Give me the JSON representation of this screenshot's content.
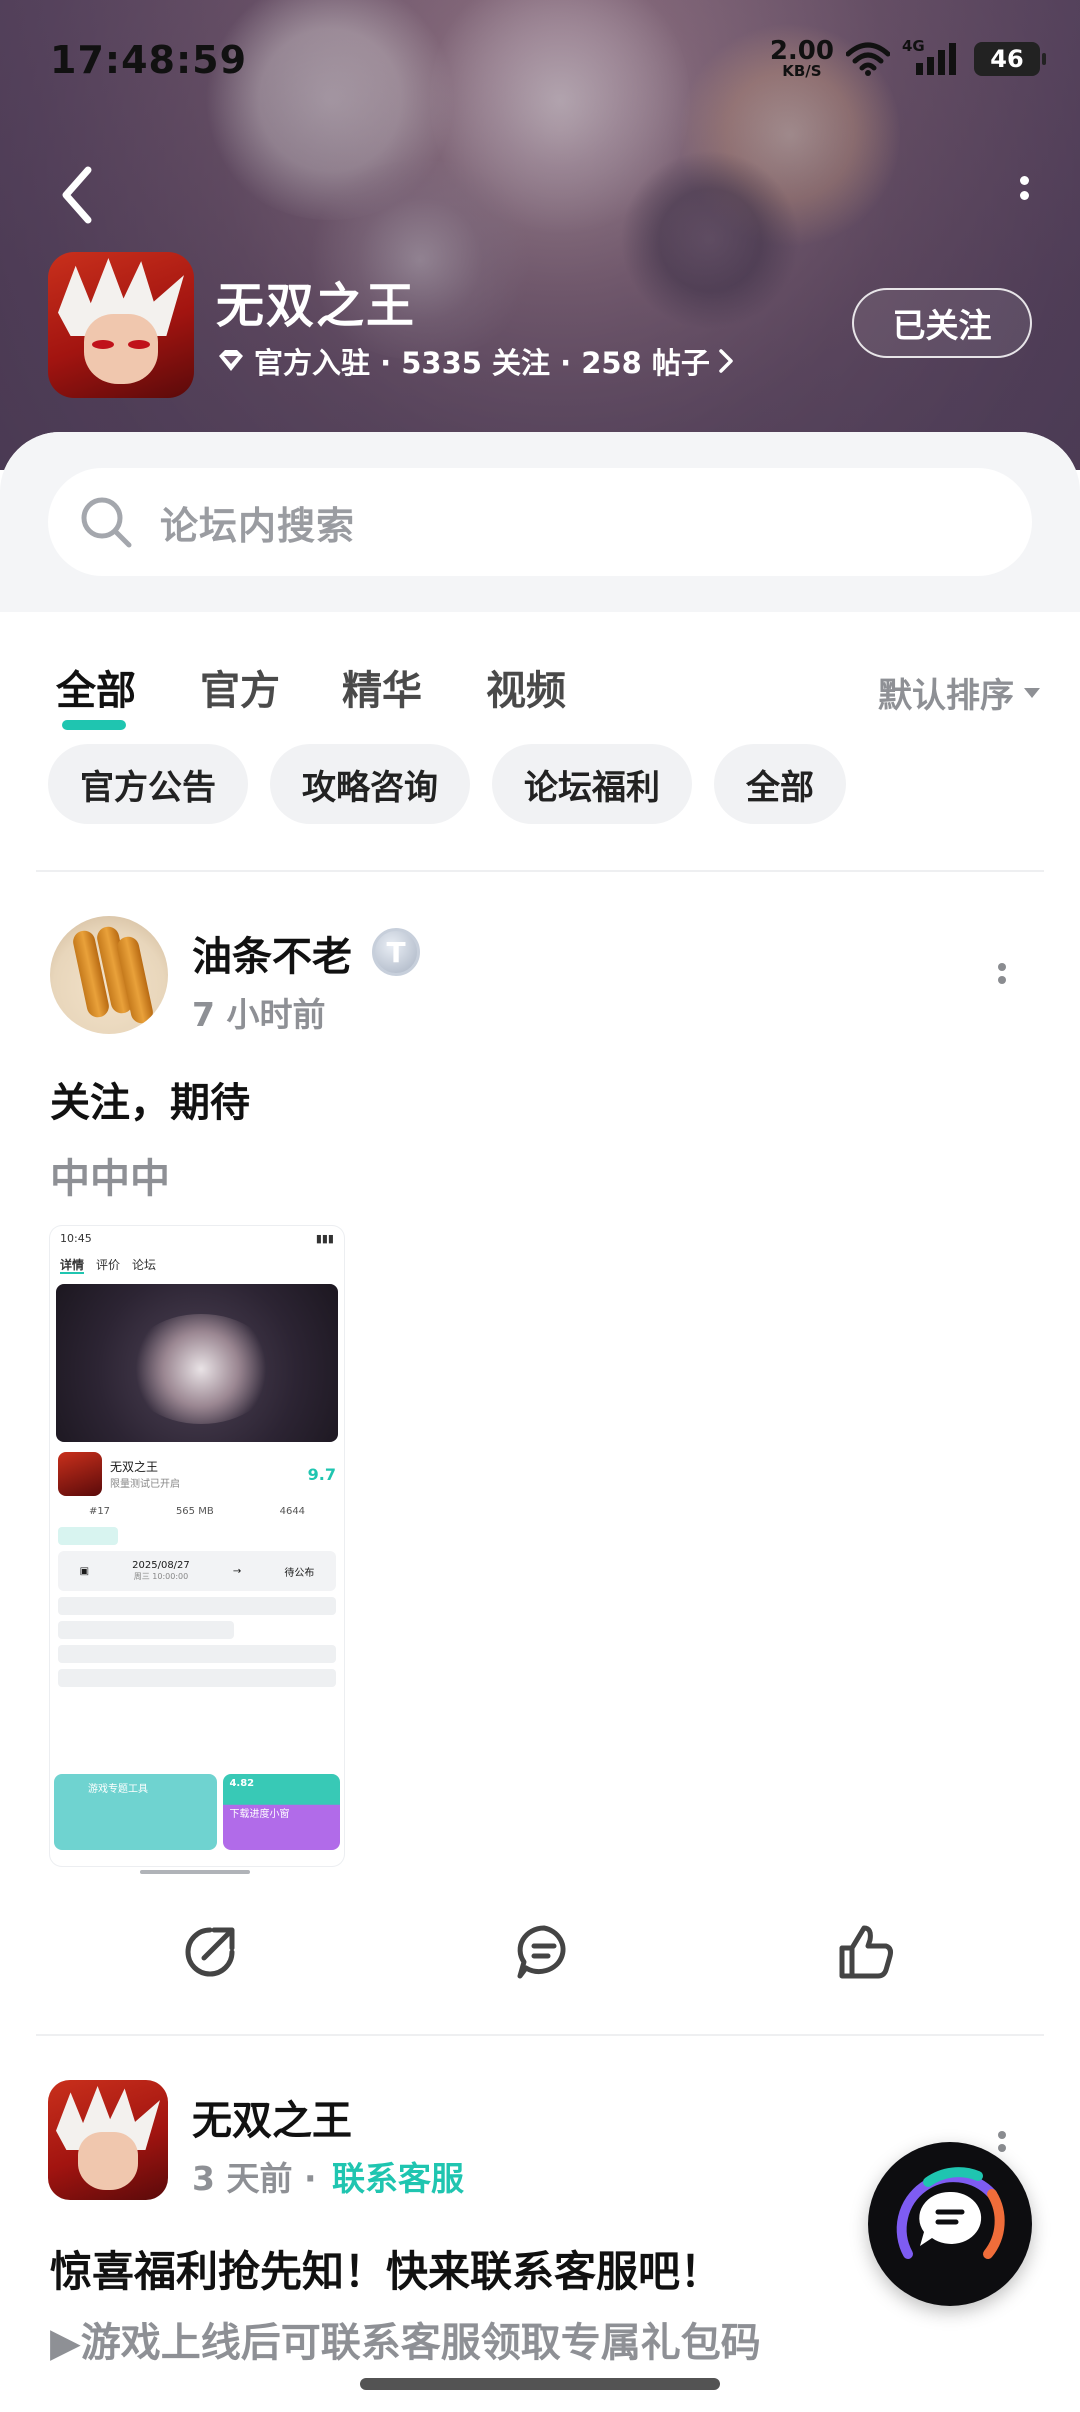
{
  "status_bar": {
    "time": "17:48:59",
    "net_speed_value": "2.00",
    "net_speed_unit": "KB/S",
    "network": "4G",
    "battery": "46"
  },
  "header": {
    "app_name": "无双之王",
    "meta": "官方入驻 · 5335 关注 · 258 帖子",
    "follow_label": "已关注"
  },
  "search": {
    "placeholder": "论坛内搜索"
  },
  "tabs": [
    {
      "label": "全部",
      "active": true
    },
    {
      "label": "官方"
    },
    {
      "label": "精华"
    },
    {
      "label": "视频"
    }
  ],
  "sort": {
    "label": "默认排序"
  },
  "chips": [
    "官方公告",
    "攻略咨询",
    "论坛福利",
    "全部"
  ],
  "posts": [
    {
      "author": "油条不老",
      "level": "T",
      "time": "7 小时前",
      "title": "关注，期待",
      "body": "中中中",
      "screenshot": {
        "time": "10:45",
        "tabs": [
          "详情",
          "评价",
          "论坛"
        ],
        "game_name": "无双之王",
        "game_sub": "限量测试已开启",
        "score": "9.7",
        "stats": [
          "#17",
          "565 MB",
          "4644"
        ],
        "date": "2025/08/27",
        "date_time": "周三 10:00:00",
        "pending": "待公布",
        "tool_title": "游戏专题工具",
        "speed": "4.82",
        "download_label": "下载进度小窗"
      }
    },
    {
      "author": "无双之王",
      "time": "3 天前",
      "time_sep": "·",
      "link": "联系客服",
      "title": "惊喜福利抢先知！快来联系客服吧！",
      "body": "▶游戏上线后可联系客服领取专属礼包码"
    }
  ],
  "colors": {
    "accent": "#1fc5b0",
    "muted_text": "#8e9095",
    "chip_bg": "#f1f2f4"
  },
  "icons": {
    "back": "chevron-left-icon",
    "more": "more-vertical-icon",
    "verified": "diamond-icon",
    "search": "search-icon",
    "share": "share-icon",
    "comment": "comment-icon",
    "like": "thumbs-up-icon",
    "fab": "chat-bubble-icon"
  }
}
